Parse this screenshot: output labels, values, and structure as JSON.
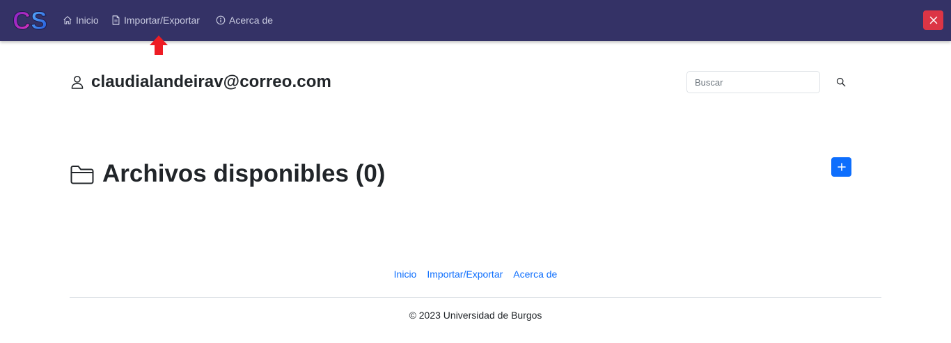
{
  "navbar": {
    "logo_text": "CS",
    "links": {
      "home": "Inicio",
      "import_export": "Importar/Exportar",
      "about": "Acerca de"
    },
    "close_icon": "close-icon",
    "background_color": "#343266"
  },
  "user": {
    "icon": "person-icon",
    "email": "claudialandeirav@correo.com"
  },
  "search": {
    "placeholder": "Buscar",
    "value": "",
    "icon": "search-icon"
  },
  "files": {
    "icon": "folder-icon",
    "title": "Archivos disponibles (0)",
    "add_icon": "plus-icon"
  },
  "footer": {
    "links": {
      "home": "Inicio",
      "import_export": "Importar/Exportar",
      "about": "Acerca de"
    },
    "copyright": "© 2023 Universidad de Burgos"
  },
  "colors": {
    "primary": "#0d6efd",
    "danger": "#dc3545",
    "annotation_arrow": "#ee1c24"
  }
}
